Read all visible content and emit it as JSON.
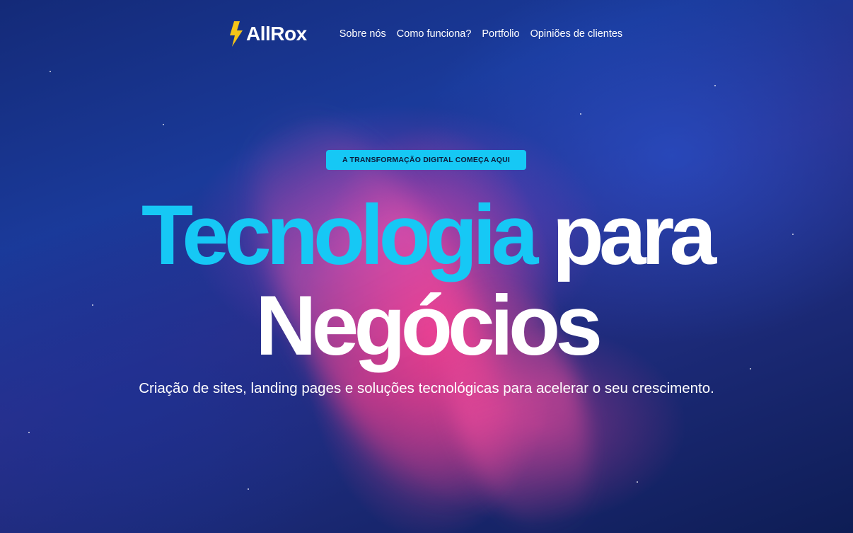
{
  "brand": {
    "logo_text": "AllRox",
    "accent_color": "#16c8f5",
    "bolt_color": "#f5c518"
  },
  "nav": {
    "items": [
      {
        "label": "Sobre nós"
      },
      {
        "label": "Como funciona?"
      },
      {
        "label": "Portfolio"
      },
      {
        "label": "Opiniões de clientes"
      }
    ]
  },
  "hero": {
    "badge": "A TRANSFORMAÇÃO DIGITAL COMEÇA AQUI",
    "headline_accent": "Tecnologia",
    "headline_rest_line1": "para",
    "headline_line2": "Negócios",
    "subtitle": "Criação de sites, landing pages e soluções tecnológicas para acelerar o seu crescimento."
  }
}
